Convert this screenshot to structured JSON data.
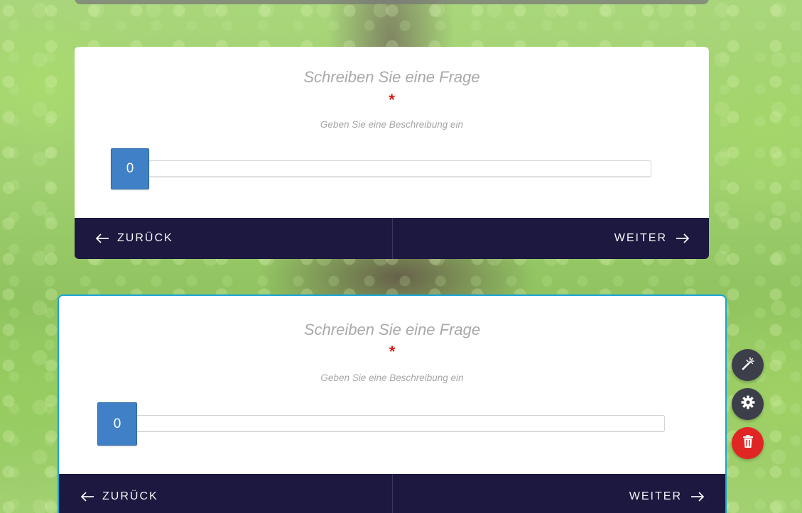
{
  "cards": [
    {
      "question": "Schreiben Sie eine Frage",
      "required_mark": "*",
      "description": "Geben Sie eine Beschreibung ein",
      "slider_value": "0",
      "back_label": "ZURÜCK",
      "next_label": "WEITER"
    },
    {
      "question": "Schreiben Sie eine Frage",
      "required_mark": "*",
      "description": "Geben Sie eine Beschreibung ein",
      "slider_value": "0",
      "back_label": "ZURÜCK",
      "next_label": "WEITER"
    }
  ],
  "toolbar": {
    "icons": [
      "magic-wand-icon",
      "gear-icon",
      "trash-icon"
    ],
    "colors": {
      "neutral": "#3c3f4a",
      "danger": "#e02625"
    }
  },
  "theme": {
    "nav_background": "#1d1840",
    "slider_handle": "#3f80c6",
    "selected_border": "#1aa3d4",
    "required_color": "#d51818"
  }
}
